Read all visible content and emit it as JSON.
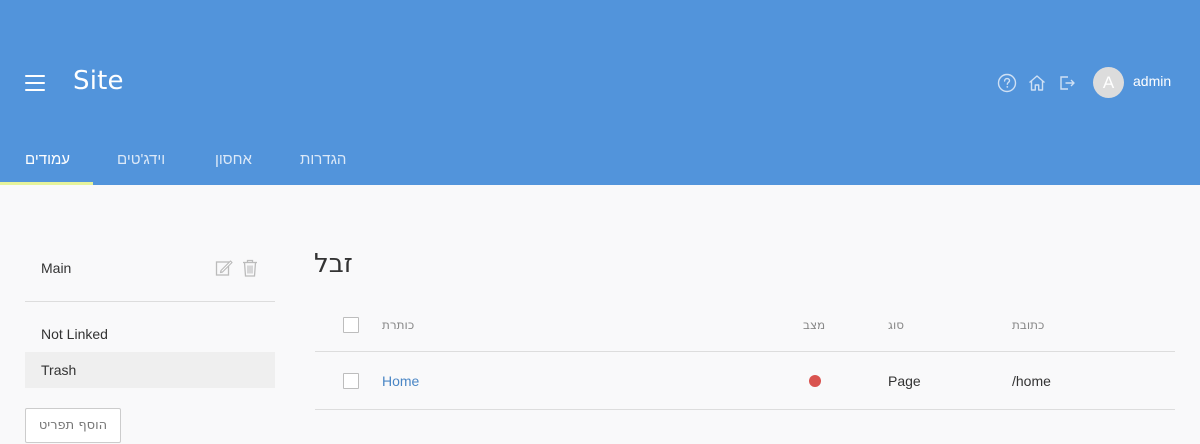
{
  "header": {
    "site_title": "Site",
    "username": "admin",
    "avatar_initial": "A",
    "icons": [
      "help-icon",
      "home-icon",
      "logout-icon"
    ]
  },
  "tabs": [
    {
      "label": "עמודים",
      "active": true
    },
    {
      "label": "וידג'טים",
      "active": false
    },
    {
      "label": "אחסון",
      "active": false
    },
    {
      "label": "הגדרות",
      "active": false
    }
  ],
  "sidebar": {
    "items": [
      {
        "label": "Main"
      },
      {
        "label": "Not Linked"
      },
      {
        "label": "Trash",
        "selected": true
      }
    ],
    "add_button": "הוסף תפריט"
  },
  "main": {
    "title": "זבל",
    "columns": {
      "title": "כותרת",
      "status": "מצב",
      "type": "סוג",
      "address": "כתובת"
    },
    "rows": [
      {
        "title": "Home",
        "status": "red",
        "type": "Page",
        "address": "/home"
      }
    ]
  },
  "colors": {
    "header_bg": "#5294db",
    "tab_indicator": "#e6f39b",
    "link": "#4a86c5",
    "status_red": "#d9534f"
  }
}
